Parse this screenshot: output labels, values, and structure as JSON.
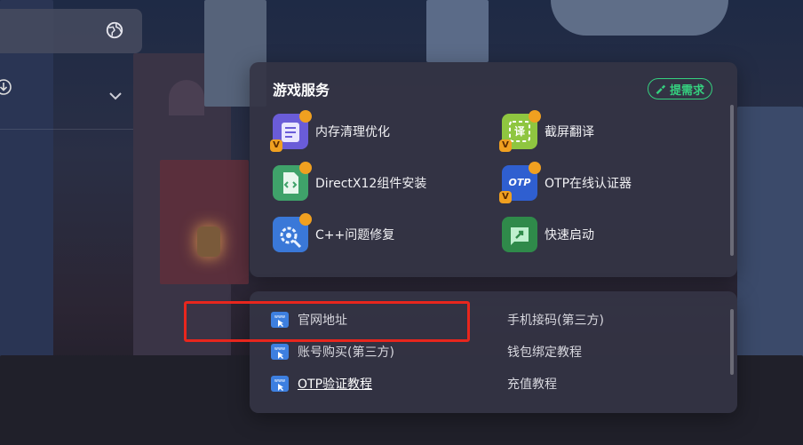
{
  "services_panel": {
    "title": "游戏服务",
    "request_button": "提需求",
    "items": [
      {
        "label": "内存清理优化",
        "icon": "memory-clean-icon",
        "badge_v": "V"
      },
      {
        "label": "截屏翻译",
        "icon": "screen-translate-icon",
        "glyph": "译",
        "badge_v": "V"
      },
      {
        "label": "DirectX12组件安装",
        "icon": "directx-install-icon"
      },
      {
        "label": "OTP在线认证器",
        "icon": "otp-authenticator-icon",
        "glyph": "OTP",
        "badge_v": "V"
      },
      {
        "label": "C++问题修复",
        "icon": "cpp-repair-icon"
      },
      {
        "label": "快速启动",
        "icon": "quick-launch-icon"
      }
    ]
  },
  "links_panel": {
    "www_badge": "www",
    "left_links": [
      {
        "label": "官网地址",
        "icon": "www-icon"
      },
      {
        "label": "账号购买(第三方)",
        "icon": "www-icon"
      },
      {
        "label": "OTP验证教程",
        "icon": "www-icon"
      }
    ],
    "right_links": [
      {
        "label": "手机接码(第三方)"
      },
      {
        "label": "钱包绑定教程"
      },
      {
        "label": "充值教程"
      }
    ]
  },
  "colors": {
    "accent_green": "#35d07f",
    "highlight_red": "#e8261d",
    "badge_orange": "#f0a020"
  }
}
